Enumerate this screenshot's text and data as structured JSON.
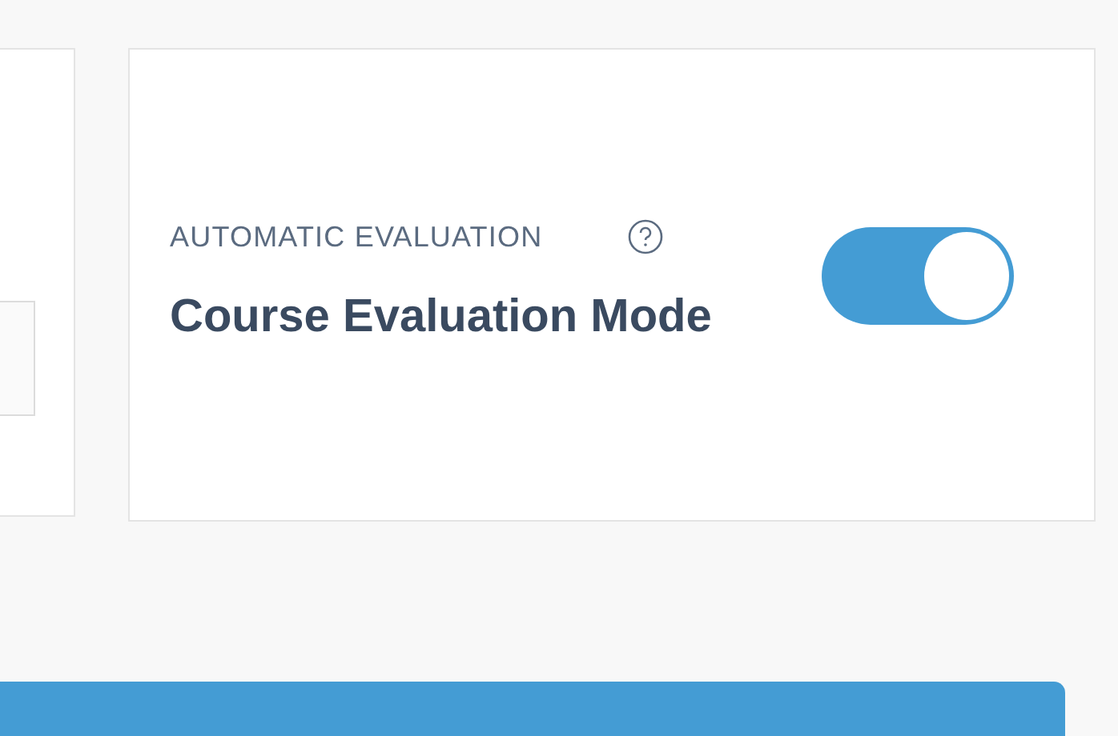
{
  "settings_card": {
    "label": "AUTOMATIC EVALUATION",
    "title": "Course Evaluation Mode",
    "toggle": {
      "on": true
    }
  }
}
